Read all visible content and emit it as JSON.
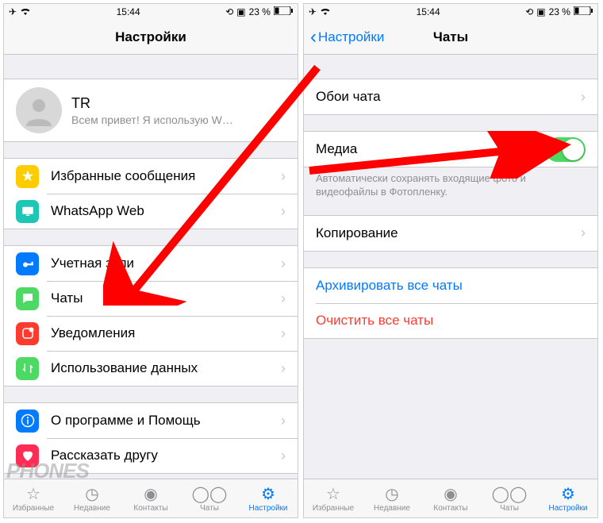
{
  "statusbar": {
    "time": "15:44",
    "battery": "23 %"
  },
  "left": {
    "nav": {
      "title": "Настройки"
    },
    "profile": {
      "name": "TR",
      "status": "Всем привет! Я использую W…"
    },
    "group2": {
      "starred": "Избранные сообщения",
      "web": "WhatsApp Web"
    },
    "group3": {
      "account": "Учетная запи",
      "chats": "Чаты",
      "notifications": "Уведомления",
      "data": "Использование данных"
    },
    "group4": {
      "about": "О программе и Помощь",
      "tell": "Рассказать другу"
    }
  },
  "right": {
    "nav": {
      "back": "Настройки",
      "title": "Чаты"
    },
    "wallpaper": "Обои чата",
    "media": "Медиа",
    "media_note": "Автоматически сохранять входящие фото и видеофайлы в Фотопленку.",
    "backup": "Копирование",
    "archive": "Архивировать все чаты",
    "clear": "Очистить все чаты"
  },
  "tabs": {
    "fav": "Избранные",
    "recent": "Недавние",
    "contacts": "Контакты",
    "chats": "Чаты",
    "settings": "Настройки"
  },
  "watermark": "PHONES"
}
